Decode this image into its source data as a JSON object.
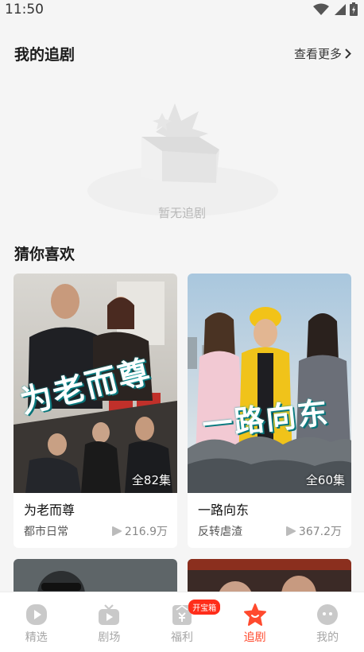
{
  "status_bar": {
    "time": "11:50"
  },
  "my_follow": {
    "title": "我的追剧",
    "more_label": "查看更多",
    "empty_text": "暂无追剧"
  },
  "recommend": {
    "title": "猜你喜欢",
    "cards": [
      {
        "poster_text": "为老而尊",
        "episodes": "全82集",
        "title": "为老而尊",
        "genre": "都市日常",
        "plays": "216.9万"
      },
      {
        "poster_text": "一路向东",
        "episodes": "全60集",
        "title": "一路向东",
        "genre": "反转虐渣",
        "plays": "367.2万"
      }
    ]
  },
  "tabbar": {
    "items": [
      {
        "label": "精选",
        "icon": "play-circle-icon"
      },
      {
        "label": "剧场",
        "icon": "tv-icon"
      },
      {
        "label": "福利",
        "icon": "gift-icon",
        "badge": "开宝箱"
      },
      {
        "label": "追剧",
        "icon": "star-icon",
        "active": true
      },
      {
        "label": "我的",
        "icon": "face-icon"
      }
    ]
  },
  "colors": {
    "accent": "#ff4a2e",
    "badge": "#ff2d1a",
    "background": "#f5f5f5"
  }
}
